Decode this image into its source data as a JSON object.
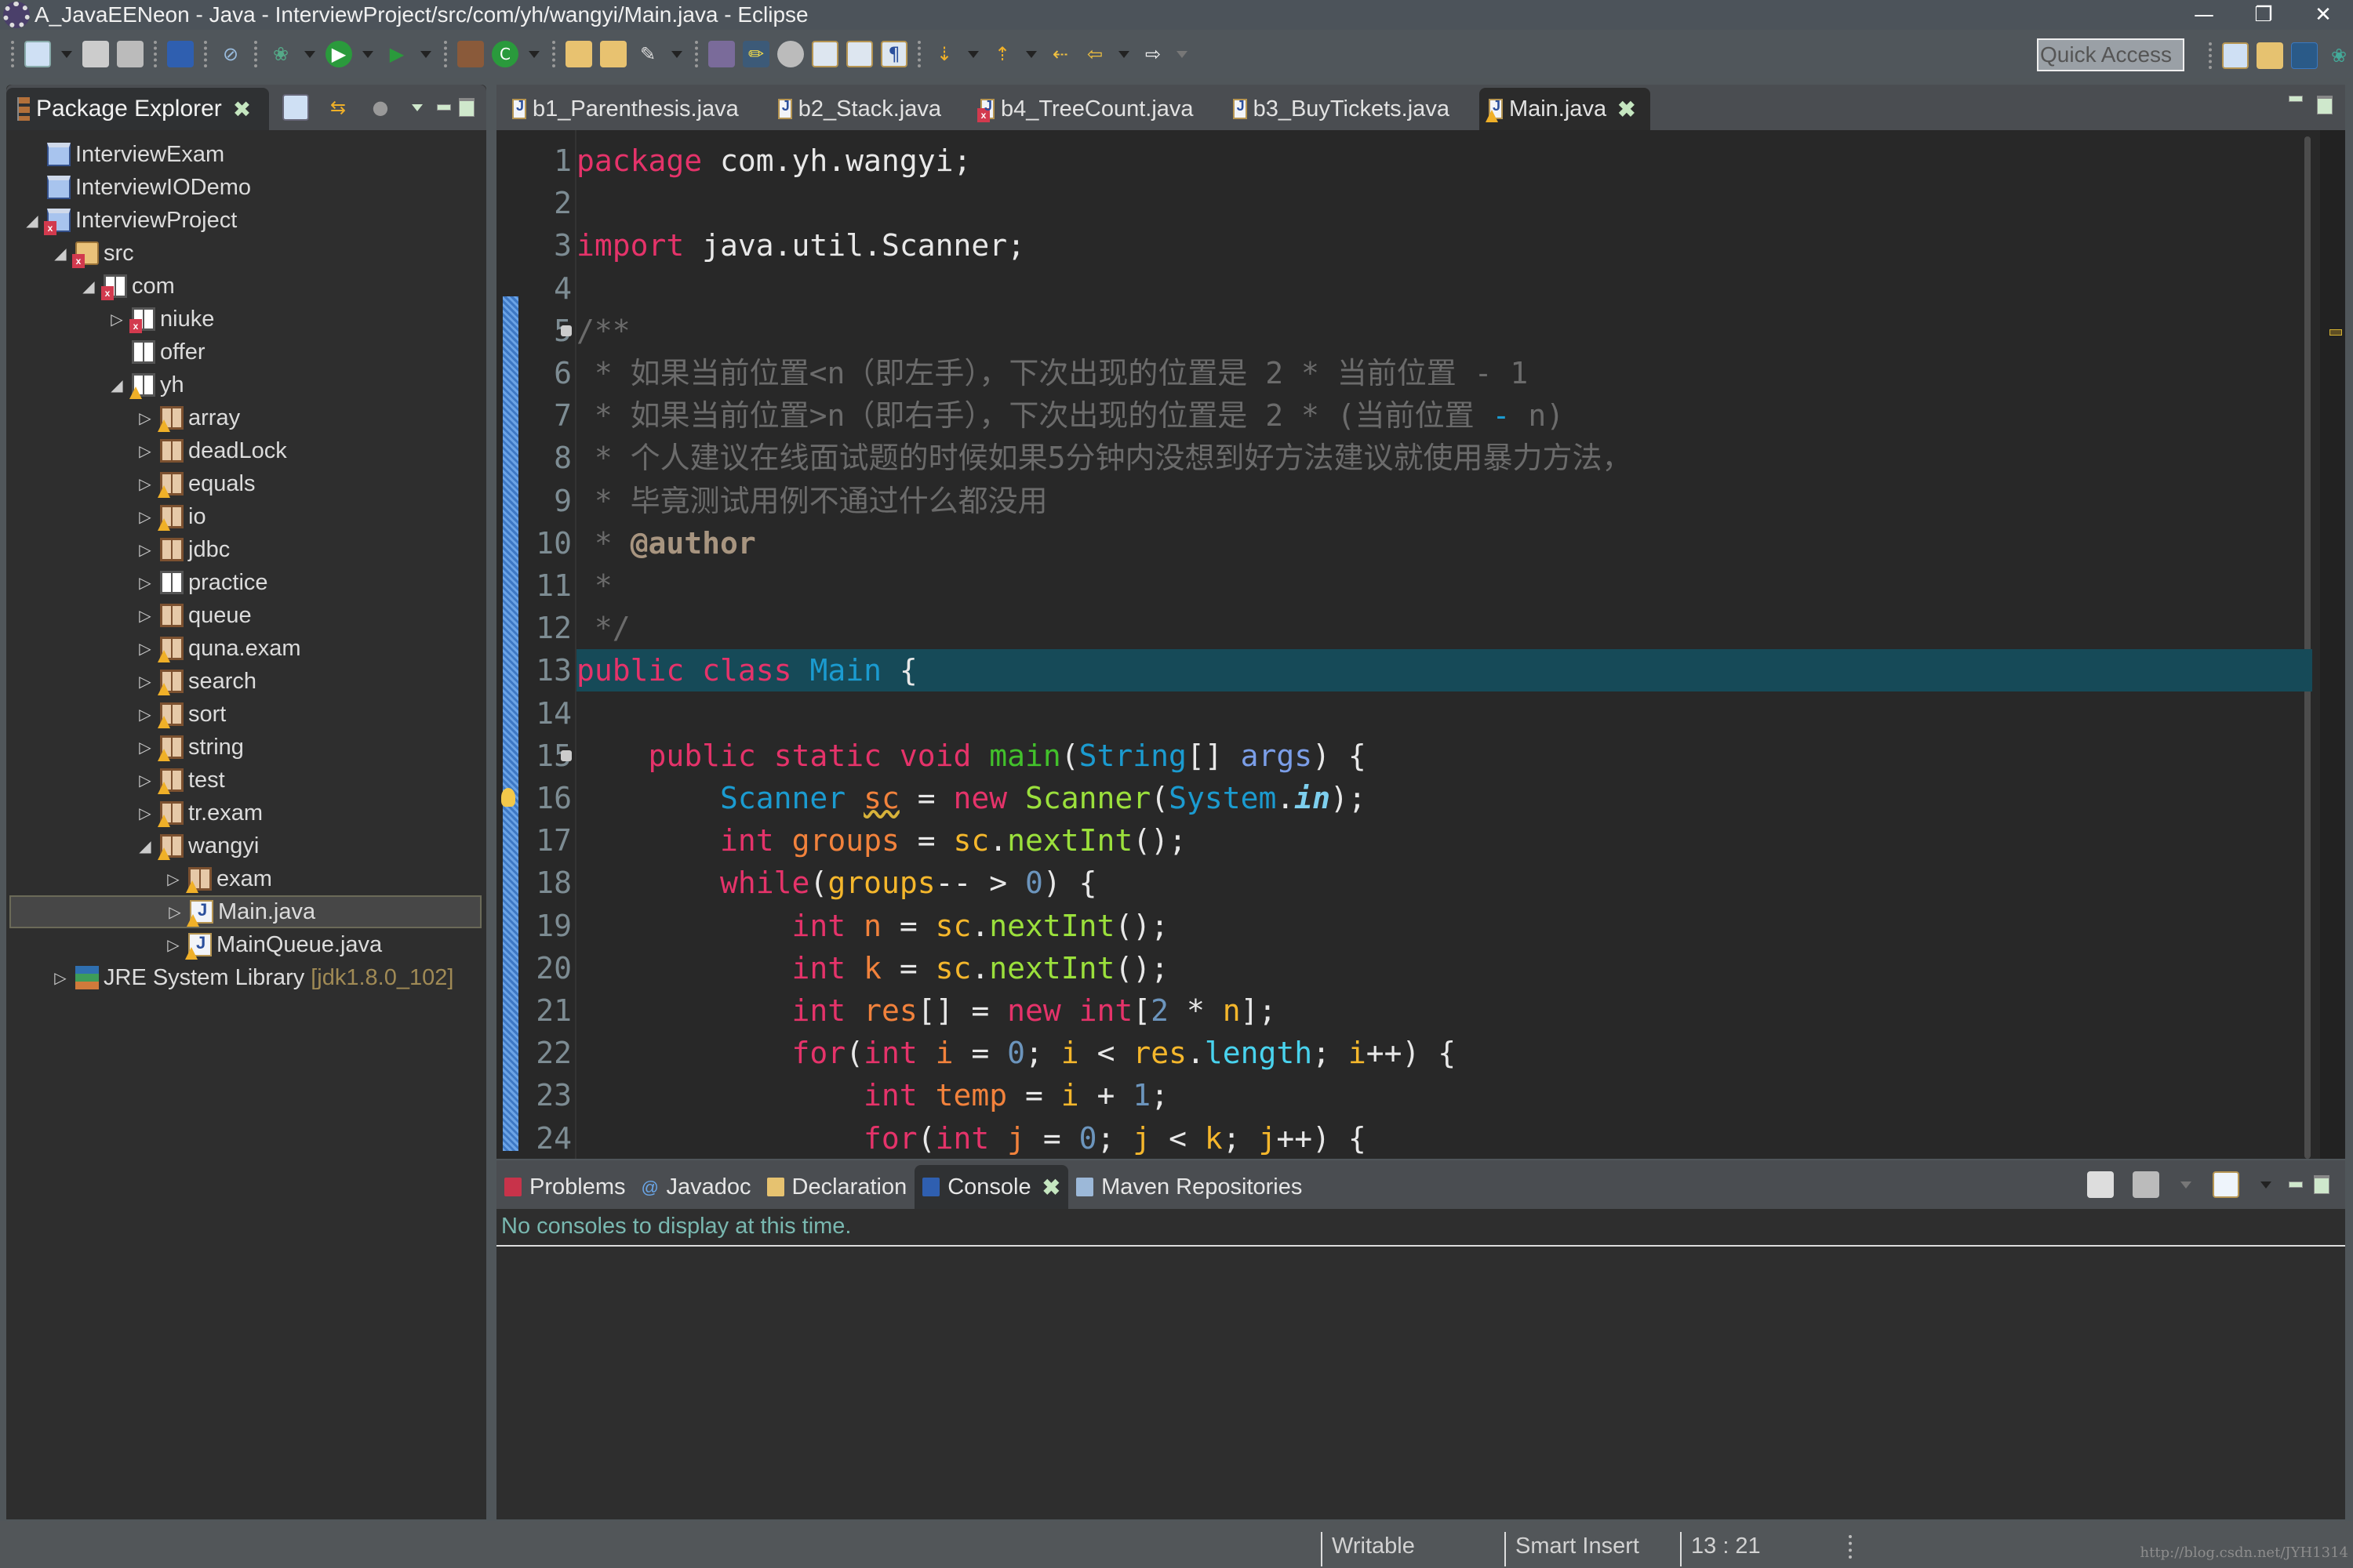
{
  "window": {
    "title": "A_JavaEENeon - Java - InterviewProject/src/com/yh/wangyi/Main.java - Eclipse",
    "controls": [
      "minimize",
      "restore",
      "close"
    ]
  },
  "toolbar": {
    "quick_access_placeholder": "Quick Access",
    "icons": [
      "new-icon",
      "save-icon",
      "save-all-icon",
      "console-icon",
      "skip-breakpoints-icon",
      "debug-icon",
      "run-icon",
      "run-external-icon",
      "new-package-icon",
      "new-class-icon",
      "open-type-icon",
      "open-task-icon",
      "annotation-icon",
      "toggle-mark-occurrences-icon",
      "highlight-icon",
      "word-wrap-icon",
      "block-selection-icon",
      "show-whitespace-icon",
      "next-annotation-icon",
      "prev-annotation-icon",
      "last-edit-icon",
      "back-icon",
      "forward-icon"
    ],
    "perspectives": [
      "open-perspective-icon",
      "java-ee-perspective-icon",
      "java-perspective-icon",
      "debug-perspective-icon"
    ]
  },
  "package_explorer": {
    "title": "Package Explorer",
    "tree": [
      {
        "label": "InterviewExam",
        "depth": 0,
        "icon": "project",
        "twisty": "none"
      },
      {
        "label": "InterviewIODemo",
        "depth": 0,
        "icon": "project",
        "twisty": "none"
      },
      {
        "label": "InterviewProject",
        "depth": 0,
        "icon": "java-project",
        "twisty": "expanded",
        "badge": "error"
      },
      {
        "label": "src",
        "depth": 1,
        "icon": "source-folder",
        "twisty": "expanded",
        "badge": "error"
      },
      {
        "label": "com",
        "depth": 2,
        "icon": "package-white",
        "twisty": "expanded",
        "badge": "error"
      },
      {
        "label": "niuke",
        "depth": 3,
        "icon": "package-white",
        "twisty": "collapsed",
        "badge": "error"
      },
      {
        "label": "offer",
        "depth": 3,
        "icon": "package-white",
        "twisty": "none"
      },
      {
        "label": "yh",
        "depth": 3,
        "icon": "package-white",
        "twisty": "expanded",
        "badge": "warning"
      },
      {
        "label": "array",
        "depth": 4,
        "icon": "package",
        "twisty": "collapsed",
        "badge": "warning"
      },
      {
        "label": "deadLock",
        "depth": 4,
        "icon": "package",
        "twisty": "collapsed"
      },
      {
        "label": "equals",
        "depth": 4,
        "icon": "package",
        "twisty": "collapsed",
        "badge": "warning"
      },
      {
        "label": "io",
        "depth": 4,
        "icon": "package",
        "twisty": "collapsed",
        "badge": "warning"
      },
      {
        "label": "jdbc",
        "depth": 4,
        "icon": "package",
        "twisty": "collapsed"
      },
      {
        "label": "practice",
        "depth": 4,
        "icon": "package-white",
        "twisty": "collapsed"
      },
      {
        "label": "queue",
        "depth": 4,
        "icon": "package",
        "twisty": "collapsed"
      },
      {
        "label": "quna.exam",
        "depth": 4,
        "icon": "package",
        "twisty": "collapsed",
        "badge": "warning"
      },
      {
        "label": "search",
        "depth": 4,
        "icon": "package",
        "twisty": "collapsed",
        "badge": "warning"
      },
      {
        "label": "sort",
        "depth": 4,
        "icon": "package",
        "twisty": "collapsed",
        "badge": "warning"
      },
      {
        "label": "string",
        "depth": 4,
        "icon": "package",
        "twisty": "collapsed",
        "badge": "warning"
      },
      {
        "label": "test",
        "depth": 4,
        "icon": "package",
        "twisty": "collapsed",
        "badge": "warning"
      },
      {
        "label": "tr.exam",
        "depth": 4,
        "icon": "package",
        "twisty": "collapsed",
        "badge": "warning"
      },
      {
        "label": "wangyi",
        "depth": 4,
        "icon": "package",
        "twisty": "expanded",
        "badge": "warning"
      },
      {
        "label": "exam",
        "depth": 5,
        "icon": "package",
        "twisty": "collapsed",
        "badge": "warning"
      },
      {
        "label": "Main.java",
        "depth": 5,
        "icon": "java-file",
        "twisty": "collapsed",
        "badge": "warning",
        "selected": true
      },
      {
        "label": "MainQueue.java",
        "depth": 5,
        "icon": "java-file",
        "twisty": "collapsed",
        "badge": "warning"
      },
      {
        "label": "JRE System Library",
        "suffix": "[jdk1.8.0_102]",
        "depth": 1,
        "icon": "library",
        "twisty": "collapsed"
      }
    ]
  },
  "editor": {
    "tabs": [
      {
        "label": "b1_Parenthesis.java",
        "active": false
      },
      {
        "label": "b2_Stack.java",
        "active": false
      },
      {
        "label": "b4_TreeCount.java",
        "active": false,
        "badge": "error"
      },
      {
        "label": "b3_BuyTickets.java",
        "active": false
      },
      {
        "label": "Main.java",
        "active": true,
        "badge": "warning"
      }
    ],
    "current_line": 13,
    "lines": [
      {
        "n": "1",
        "tokens": [
          [
            "k",
            "package"
          ],
          [
            "p",
            " com.yh.wangyi;"
          ]
        ]
      },
      {
        "n": "2",
        "tokens": []
      },
      {
        "n": "3",
        "tokens": [
          [
            "k",
            "import"
          ],
          [
            "p",
            " java.util.Scanner;"
          ]
        ]
      },
      {
        "n": "4",
        "tokens": []
      },
      {
        "n": "5",
        "fold": true,
        "tokens": [
          [
            "c",
            "/**"
          ]
        ]
      },
      {
        "n": "6",
        "tokens": [
          [
            "c",
            " * 如果当前位置<n（即左手），下次出现的位置是 2 * 当前位置 - 1"
          ]
        ]
      },
      {
        "n": "7",
        "tokens": [
          [
            "c",
            " * 如果当前位置>n（即右手），下次出现的位置是 2 * (当前位置 "
          ],
          [
            "t",
            "-"
          ],
          [
            "c",
            " n)"
          ]
        ]
      },
      {
        "n": "8",
        "tokens": [
          [
            "c",
            " * 个人建议在线面试题的时候如果5分钟内没想到好方法建议就使用暴力方法，"
          ]
        ]
      },
      {
        "n": "9",
        "tokens": [
          [
            "c",
            " * 毕竟测试用例不通过什么都没用"
          ]
        ]
      },
      {
        "n": "10",
        "tokens": [
          [
            "c",
            " * "
          ],
          [
            "tag",
            "@author"
          ]
        ]
      },
      {
        "n": "11",
        "tokens": [
          [
            "c",
            " *"
          ]
        ]
      },
      {
        "n": "12",
        "tokens": [
          [
            "c",
            " */"
          ]
        ]
      },
      {
        "n": "13",
        "tokens": [
          [
            "k",
            "public"
          ],
          [
            "p",
            " "
          ],
          [
            "k",
            "class"
          ],
          [
            "p",
            " "
          ],
          [
            "t",
            "Main"
          ],
          [
            "p",
            " {"
          ]
        ]
      },
      {
        "n": "14",
        "tokens": []
      },
      {
        "n": "15",
        "fold": true,
        "tokens": [
          [
            "p",
            "    "
          ],
          [
            "k",
            "public"
          ],
          [
            "p",
            " "
          ],
          [
            "k",
            "static"
          ],
          [
            "p",
            " "
          ],
          [
            "k",
            "void"
          ],
          [
            "p",
            " "
          ],
          [
            "m",
            "main"
          ],
          [
            "p",
            "("
          ],
          [
            "t",
            "String"
          ],
          [
            "p",
            "[] "
          ],
          [
            "a",
            "args"
          ],
          [
            "p",
            ") {"
          ]
        ]
      },
      {
        "n": "16",
        "warn": true,
        "tokens": [
          [
            "p",
            "        "
          ],
          [
            "t",
            "Scanner"
          ],
          [
            "p",
            " "
          ],
          [
            "v ul",
            "sc"
          ],
          [
            "p",
            " = "
          ],
          [
            "k",
            "new"
          ],
          [
            "p",
            " "
          ],
          [
            "s",
            "Scanner"
          ],
          [
            "p",
            "("
          ],
          [
            "t",
            "System"
          ],
          [
            "p",
            "."
          ],
          [
            "stat",
            "in"
          ],
          [
            "p",
            ");"
          ]
        ]
      },
      {
        "n": "17",
        "tokens": [
          [
            "p",
            "        "
          ],
          [
            "k",
            "int"
          ],
          [
            "p",
            " "
          ],
          [
            "v",
            "groups"
          ],
          [
            "p",
            " = "
          ],
          [
            "f",
            "sc"
          ],
          [
            "p",
            "."
          ],
          [
            "s",
            "nextInt"
          ],
          [
            "p",
            "();"
          ]
        ]
      },
      {
        "n": "18",
        "tokens": [
          [
            "p",
            "        "
          ],
          [
            "k",
            "while"
          ],
          [
            "p",
            "("
          ],
          [
            "f",
            "groups"
          ],
          [
            "p",
            "-- > "
          ],
          [
            "n",
            "0"
          ],
          [
            "p",
            ") {"
          ]
        ]
      },
      {
        "n": "19",
        "tokens": [
          [
            "p",
            "            "
          ],
          [
            "k",
            "int"
          ],
          [
            "p",
            " "
          ],
          [
            "v",
            "n"
          ],
          [
            "p",
            " = "
          ],
          [
            "f",
            "sc"
          ],
          [
            "p",
            "."
          ],
          [
            "s",
            "nextInt"
          ],
          [
            "p",
            "();"
          ]
        ]
      },
      {
        "n": "20",
        "tokens": [
          [
            "p",
            "            "
          ],
          [
            "k",
            "int"
          ],
          [
            "p",
            " "
          ],
          [
            "v",
            "k"
          ],
          [
            "p",
            " = "
          ],
          [
            "f",
            "sc"
          ],
          [
            "p",
            "."
          ],
          [
            "s",
            "nextInt"
          ],
          [
            "p",
            "();"
          ]
        ]
      },
      {
        "n": "21",
        "tokens": [
          [
            "p",
            "            "
          ],
          [
            "k",
            "int"
          ],
          [
            "p",
            " "
          ],
          [
            "v",
            "res"
          ],
          [
            "p",
            "[] = "
          ],
          [
            "k",
            "new"
          ],
          [
            "p",
            " "
          ],
          [
            "k",
            "int"
          ],
          [
            "p",
            "["
          ],
          [
            "n",
            "2"
          ],
          [
            "p",
            " * "
          ],
          [
            "f",
            "n"
          ],
          [
            "p",
            "];"
          ]
        ]
      },
      {
        "n": "22",
        "tokens": [
          [
            "p",
            "            "
          ],
          [
            "k",
            "for"
          ],
          [
            "p",
            "("
          ],
          [
            "k",
            "int"
          ],
          [
            "p",
            " "
          ],
          [
            "v",
            "i"
          ],
          [
            "p",
            " = "
          ],
          [
            "n",
            "0"
          ],
          [
            "p",
            "; "
          ],
          [
            "f",
            "i"
          ],
          [
            "p",
            " < "
          ],
          [
            "f",
            "res"
          ],
          [
            "p",
            "."
          ],
          [
            "len",
            "length"
          ],
          [
            "p",
            "; "
          ],
          [
            "f",
            "i"
          ],
          [
            "p",
            "++) {"
          ]
        ]
      },
      {
        "n": "23",
        "tokens": [
          [
            "p",
            "                "
          ],
          [
            "k",
            "int"
          ],
          [
            "p",
            " "
          ],
          [
            "v",
            "temp"
          ],
          [
            "p",
            " = "
          ],
          [
            "f",
            "i"
          ],
          [
            "p",
            " + "
          ],
          [
            "n",
            "1"
          ],
          [
            "p",
            ";"
          ]
        ]
      },
      {
        "n": "24",
        "tokens": [
          [
            "p",
            "                "
          ],
          [
            "k",
            "for"
          ],
          [
            "p",
            "("
          ],
          [
            "k",
            "int"
          ],
          [
            "p",
            " "
          ],
          [
            "v",
            "j"
          ],
          [
            "p",
            " = "
          ],
          [
            "n",
            "0"
          ],
          [
            "p",
            "; "
          ],
          [
            "f",
            "j"
          ],
          [
            "p",
            " < "
          ],
          [
            "f",
            "k"
          ],
          [
            "p",
            "; "
          ],
          [
            "f",
            "j"
          ],
          [
            "p",
            "++) {"
          ]
        ]
      }
    ]
  },
  "bottom_panel": {
    "tabs": [
      {
        "label": "Problems",
        "icon": "problems-icon",
        "active": false
      },
      {
        "label": "Javadoc",
        "icon": "javadoc-icon",
        "active": false
      },
      {
        "label": "Declaration",
        "icon": "declaration-icon",
        "active": false
      },
      {
        "label": "Console",
        "icon": "console-icon",
        "active": true
      },
      {
        "label": "Maven Repositories",
        "icon": "maven-icon",
        "active": false
      }
    ],
    "message": "No consoles to display at this time."
  },
  "status_bar": {
    "mode": "Writable",
    "insert_mode": "Smart Insert",
    "position": "13 : 21",
    "watermark": "http://blog.csdn.net/JYH1314"
  }
}
